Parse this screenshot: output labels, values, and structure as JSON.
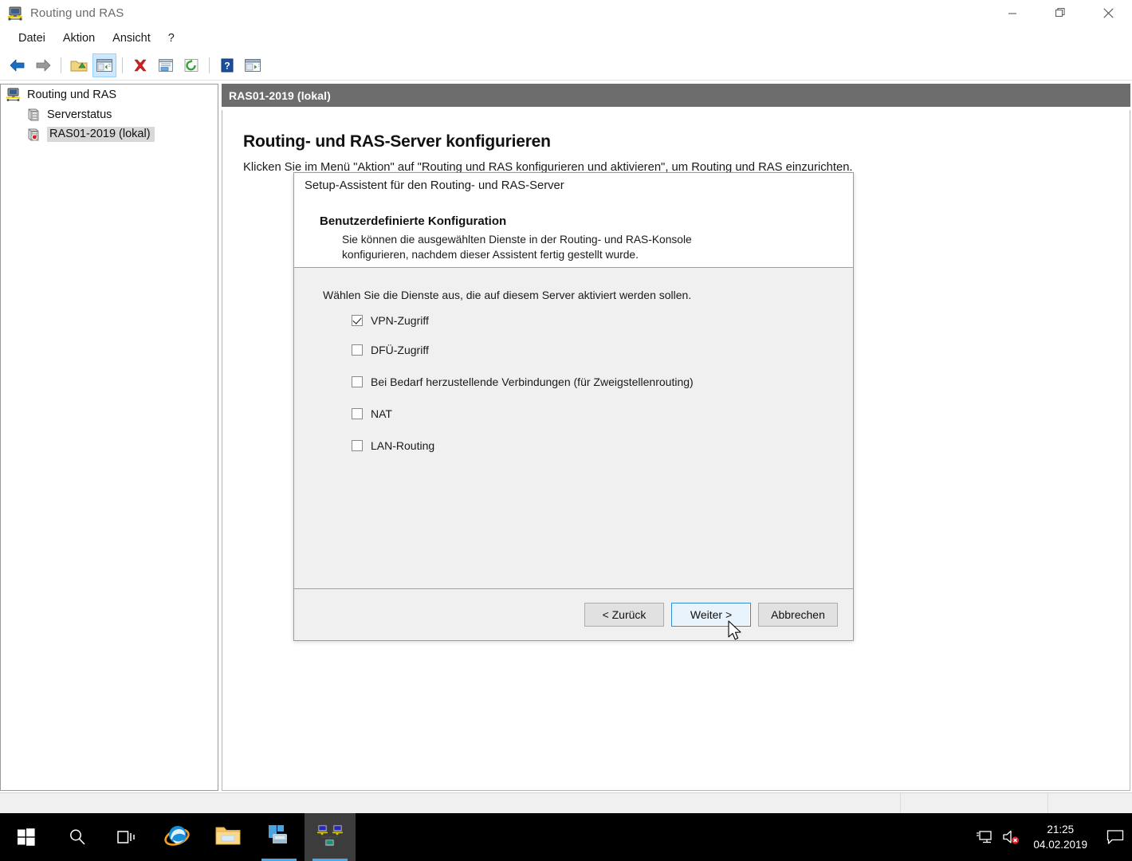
{
  "window": {
    "title": "Routing und RAS",
    "icon": "routing-ras-icon",
    "controls": {
      "minimize": "—",
      "restore": "❐",
      "close": "✕"
    }
  },
  "menubar": {
    "items": [
      {
        "label": "Datei",
        "name": "menu-datei"
      },
      {
        "label": "Aktion",
        "name": "menu-aktion"
      },
      {
        "label": "Ansicht",
        "name": "menu-ansicht"
      },
      {
        "label": "?",
        "name": "menu-hilfe"
      }
    ]
  },
  "toolbar": {
    "buttons": [
      {
        "name": "back-icon",
        "title": "Zurück"
      },
      {
        "name": "forward-icon",
        "title": "Vorwärts"
      },
      {
        "name": "up-folder-icon",
        "title": "Eine Ebene nach oben"
      },
      {
        "name": "show-hide-tree-icon",
        "title": "Konsolenstruktur ein-/ausblenden",
        "active": true
      },
      {
        "name": "delete-icon",
        "title": "Löschen"
      },
      {
        "name": "properties-icon",
        "title": "Eigenschaften"
      },
      {
        "name": "refresh-icon",
        "title": "Aktualisieren"
      },
      {
        "name": "help-icon",
        "title": "Hilfe"
      },
      {
        "name": "export-list-icon",
        "title": "Liste exportieren"
      }
    ]
  },
  "tree": {
    "items": [
      {
        "label": "Routing und RAS",
        "icon": "routing-ras-root-icon",
        "level": 1,
        "selected": false,
        "name": "tree-item-routing-und-ras"
      },
      {
        "label": "Serverstatus",
        "icon": "server-status-icon",
        "level": 2,
        "selected": false,
        "name": "tree-item-serverstatus"
      },
      {
        "label": "RAS01-2019 (lokal)",
        "icon": "ras-server-icon",
        "level": 2,
        "selected": true,
        "name": "tree-item-ras01-2019"
      }
    ]
  },
  "right_pane": {
    "header": "RAS01-2019 (lokal)",
    "title": "Routing- und RAS-Server konfigurieren",
    "subtitle": "Klicken Sie im Menü \"Aktion\" auf \"Routing und RAS konfigurieren und aktivieren\", um Routing und RAS einzurichten."
  },
  "dialog": {
    "wizard_name": "Setup-Assistent für den Routing- und RAS-Server",
    "step_title": "Benutzerdefinierte Konfiguration",
    "step_desc_line1": "Sie können die ausgewählten Dienste in der Routing- und RAS-Konsole",
    "step_desc_line2": "konfigurieren, nachdem dieser Assistent fertig gestellt wurde.",
    "prompt": "Wählen Sie die Dienste aus, die auf diesem Server aktiviert werden sollen.",
    "options": [
      {
        "label": "VPN-Zugriff",
        "checked": true,
        "name": "checkbox-vpn-zugriff"
      },
      {
        "label": "DFÜ-Zugriff",
        "checked": false,
        "name": "checkbox-dfue-zugriff"
      },
      {
        "label": "Bei Bedarf herzustellende Verbindungen (für Zweigstellenrouting)",
        "checked": false,
        "name": "checkbox-bedarf-verbindungen"
      },
      {
        "label": "NAT",
        "checked": false,
        "name": "checkbox-nat"
      },
      {
        "label": "LAN-Routing",
        "checked": false,
        "name": "checkbox-lan-routing"
      }
    ],
    "buttons": {
      "back": "< Zurück",
      "next": "Weiter >",
      "cancel": "Abbrechen"
    }
  },
  "statusbar": {
    "segments": [
      "",
      "",
      ""
    ]
  },
  "taskbar": {
    "start": "start-icon",
    "search": "search-icon",
    "taskview": "task-view-icon",
    "apps": [
      {
        "name": "taskbar-internet-explorer",
        "icon": "internet-explorer-icon",
        "running": false,
        "active": false
      },
      {
        "name": "taskbar-file-explorer",
        "icon": "file-explorer-icon",
        "running": false,
        "active": false
      },
      {
        "name": "taskbar-server-manager",
        "icon": "server-manager-icon",
        "running": true,
        "active": false
      },
      {
        "name": "taskbar-routing-ras",
        "icon": "routing-ras-icon",
        "running": true,
        "active": true
      }
    ],
    "tray": [
      {
        "name": "network-icon"
      },
      {
        "name": "volume-muted-icon"
      }
    ],
    "clock_time": "21:25",
    "clock_date": "04.02.2019",
    "action_center": "action-center-icon"
  },
  "colors": {
    "pane_header_bg": "#6d6d6d",
    "dialog_bg": "#f0f0f0",
    "accent_blue": "#2a8bd6",
    "taskbar_bg": "#000000",
    "tree_selection": "#d8d8d8"
  }
}
